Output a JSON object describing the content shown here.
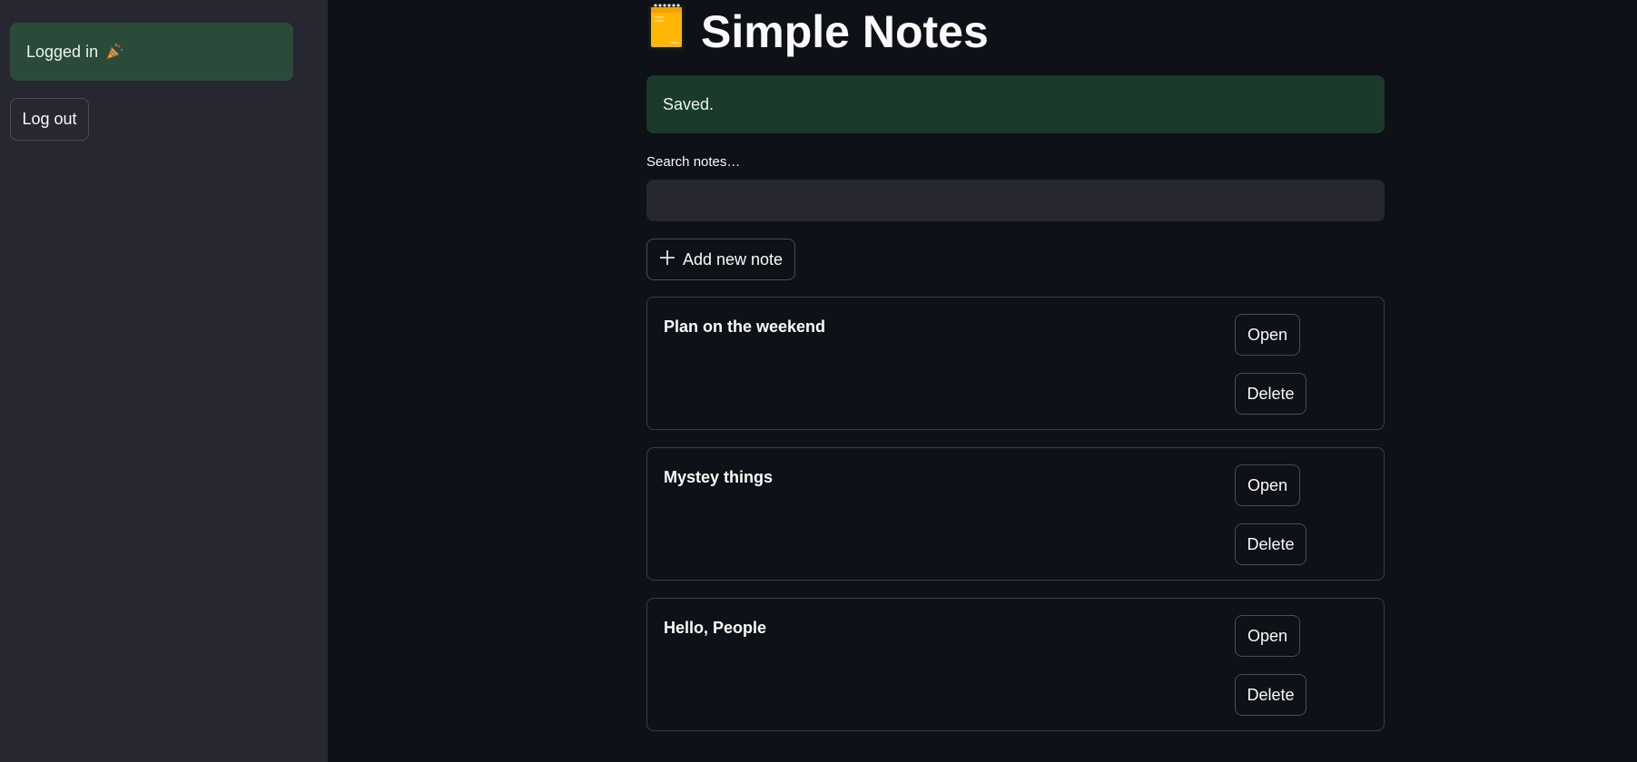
{
  "sidebar": {
    "login_status": "Logged in",
    "login_icon": "party-popper-icon",
    "logout_label": "Log out"
  },
  "header": {
    "title": "Simple Notes",
    "title_icon": "notebook-icon"
  },
  "alert": {
    "message": "Saved."
  },
  "search": {
    "label": "Search notes…",
    "value": "",
    "placeholder": ""
  },
  "add_button": {
    "label": "Add new note",
    "icon": "plus-icon"
  },
  "notes": [
    {
      "title": "Plan on the weekend",
      "open_label": "Open",
      "delete_label": "Delete"
    },
    {
      "title": "Mystey things",
      "open_label": "Open",
      "delete_label": "Delete"
    },
    {
      "title": "Hello, People",
      "open_label": "Open",
      "delete_label": "Delete"
    }
  ],
  "colors": {
    "background": "#0e1117",
    "sidebar": "#262730",
    "success_bg": "#1b3a29",
    "login_bg": "#2c4a3a",
    "notebook": "#ffb703"
  }
}
